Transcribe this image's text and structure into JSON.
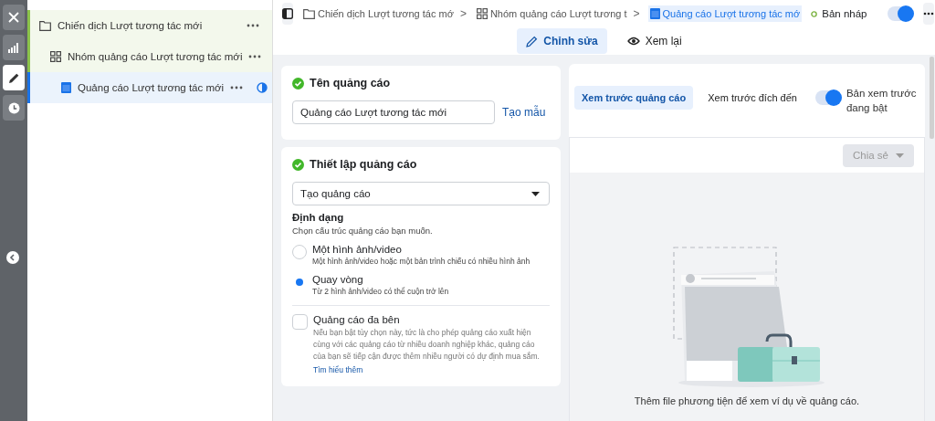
{
  "rail": {
    "items": [
      {
        "kind": "close",
        "selected": false
      },
      {
        "kind": "chart",
        "selected": false
      },
      {
        "kind": "edit",
        "selected": true
      },
      {
        "kind": "history",
        "selected": false
      }
    ],
    "collapse": {
      "kind": "back"
    }
  },
  "tree": [
    {
      "kind": "campaign",
      "label": "Chiến dịch Lượt tương tác mới",
      "selected": false,
      "status_icon": false,
      "children": [
        {
          "kind": "adset",
          "label": "Nhóm quảng cáo Lượt tương tác mới",
          "selected": false,
          "status_icon": false,
          "children": [
            {
              "kind": "ad",
              "label": "Quảng cáo Lượt tương tác mới",
              "selected": true,
              "status_icon": true
            }
          ]
        }
      ]
    }
  ],
  "topbar": {
    "breadcrumbs": [
      {
        "kind": "campaign",
        "label": "Chiến dịch Lượt tương tác mớ",
        "selected": false
      },
      {
        "kind": "adset",
        "label": "Nhóm quảng cáo Lượt tương t",
        "selected": false
      },
      {
        "kind": "ad",
        "label": "Quảng cáo Lượt tương tác mớ",
        "selected": true
      }
    ],
    "separator": ">",
    "status": "Bản nháp",
    "toggle_on": true
  },
  "modes": [
    {
      "kind": "edit",
      "label": "Chỉnh sửa",
      "selected": true
    },
    {
      "kind": "review",
      "label": "Xem lại",
      "selected": false
    }
  ],
  "name_card": {
    "title": "Tên quảng cáo",
    "complete": true,
    "value": "Quảng cáo Lượt tương tác mới",
    "link": "Tạo mẫu"
  },
  "setup_card": {
    "title": "Thiết lập quảng cáo",
    "complete": true,
    "select": "Tạo quảng cáo",
    "section": "Định dạng",
    "hint": "Chọn cấu trúc quảng cáo bạn muốn.",
    "options": [
      {
        "title": "Một hình ảnh/video",
        "description": "Một hình ảnh/video hoặc một bản trình chiếu có nhiều hình ảnh",
        "selected": false
      },
      {
        "title": "Quay vòng",
        "description": "Từ 2 hình ảnh/video có thể cuộn trở lên",
        "selected": true
      }
    ],
    "multi": {
      "title": "Quảng cáo đa bên",
      "checked": false,
      "description": "Nếu bạn bật tùy chọn này, tức là cho phép quảng cáo xuất hiện cùng với các quảng cáo từ nhiều doanh nghiệp khác, quảng cáo của bạn sẽ tiếp cận được thêm nhiều người có dự định mua sắm.",
      "link": "Tìm hiểu thêm"
    }
  },
  "preview": {
    "tabs": [
      {
        "label": "Xem trước quảng cáo",
        "selected": true
      },
      {
        "label": "Xem trước đích đến",
        "selected": false
      }
    ],
    "toggle_on": true,
    "toggle_label": "Bản xem trước đang bật",
    "share": {
      "label": "Chia sẻ",
      "disabled": true
    },
    "caption": "Thêm file phương tiện để xem ví dụ về quảng cáo."
  }
}
